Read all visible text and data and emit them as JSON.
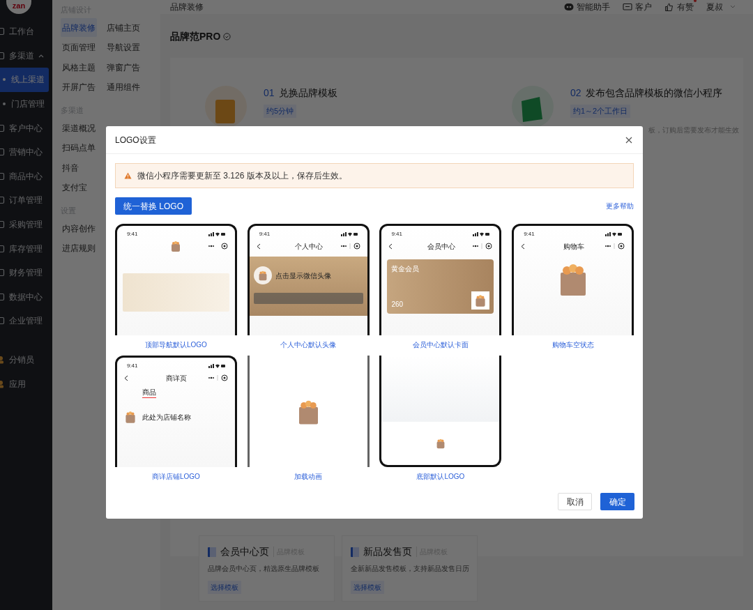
{
  "sidebar": {
    "logo": "zan",
    "items": [
      {
        "label": "工作台",
        "kind": "item",
        "selected": false
      },
      {
        "label": "多渠道",
        "kind": "group",
        "expanded": true,
        "selected": false,
        "children": [
          {
            "label": "线上渠道",
            "selected": true
          },
          {
            "label": "门店管理",
            "selected": false
          }
        ]
      },
      {
        "label": "客户中心",
        "kind": "item",
        "selected": false
      },
      {
        "label": "营销中心",
        "kind": "item",
        "selected": false
      },
      {
        "label": "商品中心",
        "kind": "item",
        "selected": false
      },
      {
        "label": "订单管理",
        "kind": "item",
        "selected": false
      },
      {
        "label": "采购管理",
        "kind": "item",
        "selected": false
      },
      {
        "label": "库存管理",
        "kind": "item",
        "selected": false
      },
      {
        "label": "财务管理",
        "kind": "item",
        "selected": false
      },
      {
        "label": "数据中心",
        "kind": "item",
        "selected": false
      },
      {
        "label": "企业管理",
        "kind": "item",
        "selected": false
      },
      {
        "label": "分销员",
        "kind": "app",
        "selected": false
      },
      {
        "label": "应用",
        "kind": "app",
        "selected": false
      }
    ]
  },
  "subnav": {
    "sections": [
      {
        "heading": "店铺设计",
        "items": [
          {
            "label": "品牌装修",
            "selected": true
          },
          {
            "label": "页面管理",
            "selected": false
          },
          {
            "label": "风格主题",
            "selected": false
          },
          {
            "label": "开屏广告",
            "selected": false
          },
          {
            "label": "店铺主页",
            "selected": false
          },
          {
            "label": "导航设置",
            "selected": false
          },
          {
            "label": "弹窗广告",
            "selected": false
          },
          {
            "label": "通用组件",
            "selected": false
          }
        ]
      },
      {
        "heading": "多渠道",
        "items": [
          {
            "label": "渠道概况",
            "selected": false
          },
          {
            "label": "扫码点单",
            "selected": false
          },
          {
            "label": "抖音",
            "selected": false
          },
          {
            "label": "支付宝",
            "selected": false
          }
        ]
      },
      {
        "heading": "设置",
        "items": [
          {
            "label": "内容创作",
            "selected": false
          },
          {
            "label": "进店规则",
            "selected": false
          }
        ]
      }
    ]
  },
  "topbar": {
    "breadcrumb": "品牌装修",
    "actions": [
      {
        "label": "智能助手",
        "kind": "assistant",
        "badge": false
      },
      {
        "label": "客户",
        "kind": "chat",
        "badge": false
      },
      {
        "label": "有赞",
        "kind": "like",
        "badge": true
      },
      {
        "label": "夏叔",
        "kind": "user",
        "badge": false
      }
    ]
  },
  "page": {
    "title": "品牌范PRO",
    "steps": [
      {
        "number": "01",
        "title": "兑换品牌模板",
        "duration": "约5分钟"
      },
      {
        "number": "02",
        "title": "发布包含品牌模板的微信小程序",
        "duration": "约1～2个工作日",
        "note": "板，订购后需要发布才能生效"
      }
    ],
    "cards": [
      {
        "title": "会员中心页",
        "tag": "品牌模板",
        "description": "品牌会员中心页，精选原生品牌模板",
        "action": "选择模板"
      },
      {
        "title": "新品发售页",
        "tag": "品牌模板",
        "description": "全新新品发售模板，支持新品发售日历",
        "action": "选择模板"
      }
    ]
  },
  "dialog": {
    "title": "LOGO设置",
    "alert": "微信小程序需要更新至 3.126 版本及以上，保存后生效。",
    "primary_action": "统一替换 LOGO",
    "help_link": "更多帮助",
    "previews": [
      {
        "kind": "nav-logo",
        "time": "9:41",
        "label": "顶部导航默认LOGO"
      },
      {
        "kind": "profile",
        "time": "9:41",
        "screen_title": "个人中心",
        "headline": "点击显示微信头像",
        "label": "个人中心默认头像"
      },
      {
        "kind": "member-card",
        "time": "9:41",
        "screen_title": "会员中心",
        "headline": "黄金会员",
        "points": "260",
        "label": "会员中心默认卡面"
      },
      {
        "kind": "cart",
        "time": "9:41",
        "screen_title": "购物车",
        "label": "购物车空状态"
      },
      {
        "kind": "product",
        "time": "9:41",
        "screen_title": "商详页",
        "tab": "商品",
        "headline": "此处为店铺名称",
        "label": "商详店铺LOGO"
      },
      {
        "kind": "loading",
        "label": "加载动画"
      },
      {
        "kind": "footer",
        "label": "底部默认LOGO"
      }
    ],
    "buttons": [
      {
        "label": "取消",
        "kind": "secondary"
      },
      {
        "label": "确定",
        "kind": "primary"
      }
    ]
  }
}
